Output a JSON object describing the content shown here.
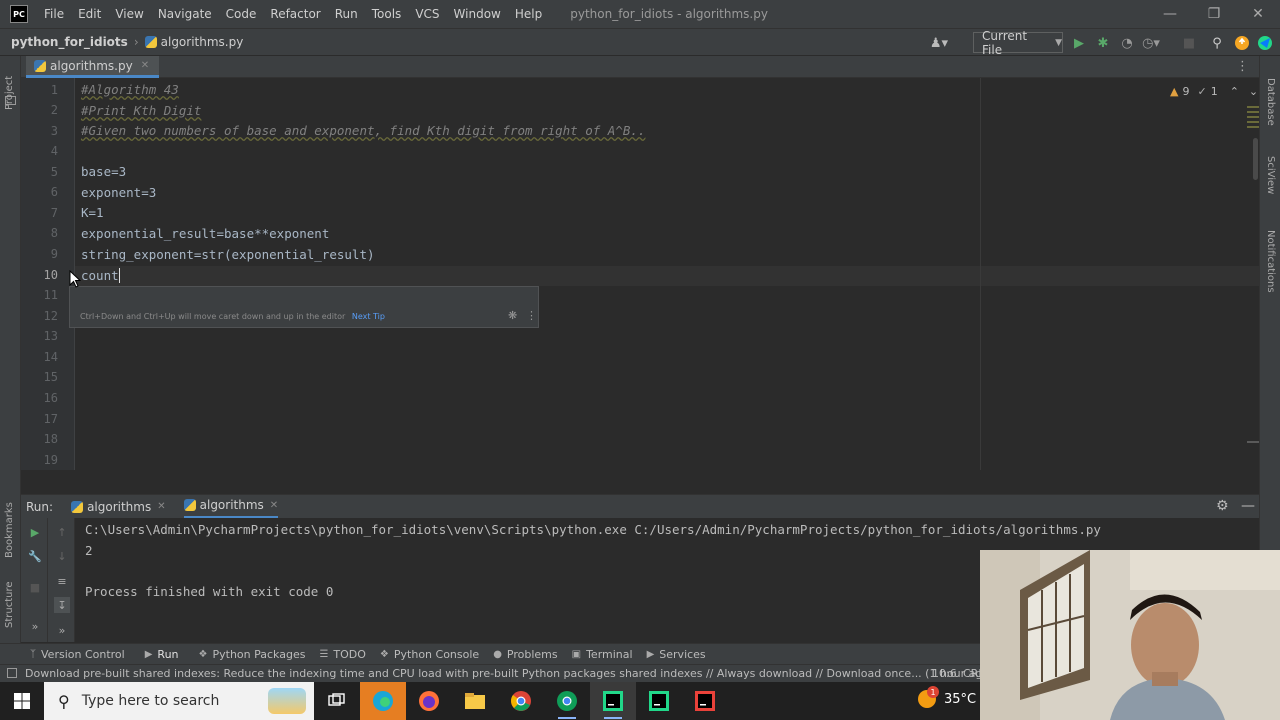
{
  "window": {
    "app_logo": "PC",
    "title": "python_for_idiots - algorithms.py",
    "menu": [
      "File",
      "Edit",
      "View",
      "Navigate",
      "Code",
      "Refactor",
      "Run",
      "Tools",
      "VCS",
      "Window",
      "Help"
    ]
  },
  "navbar": {
    "project": "python_for_idiots",
    "file": "algorithms.py",
    "run_config": "Current File"
  },
  "editor": {
    "tab_label": "algorithms.py",
    "inspection": {
      "warnings": "9",
      "weak_warnings": "1"
    },
    "line_numbers": [
      "1",
      "2",
      "3",
      "4",
      "5",
      "6",
      "7",
      "8",
      "9",
      "10",
      "11",
      "12",
      "13",
      "14",
      "15",
      "16",
      "17",
      "18",
      "19"
    ],
    "lines": [
      {
        "text": "#Algorithm 43",
        "kind": "comment"
      },
      {
        "text": "#Print Kth Digit",
        "kind": "comment"
      },
      {
        "text": "#Given two numbers of base and exponent, find Kth digit from right of A^B..",
        "kind": "comment"
      },
      {
        "text": "",
        "kind": "code"
      },
      {
        "text": "base=3",
        "kind": "code"
      },
      {
        "text": "exponent=3",
        "kind": "code"
      },
      {
        "text": "K=1",
        "kind": "code"
      },
      {
        "text": "exponential_result=base**exponent",
        "kind": "code"
      },
      {
        "text": "string_exponent=str(exponential_result)",
        "kind": "code"
      },
      {
        "text": "count",
        "kind": "code"
      }
    ],
    "tip": {
      "text": "Ctrl+Down and Ctrl+Up will move caret down and up in the editor",
      "link": "Next Tip"
    }
  },
  "side_labels": {
    "left": [
      "Project",
      "Bookmarks",
      "Structure"
    ],
    "right": [
      "Database",
      "SciView",
      "Notifications"
    ]
  },
  "run_panel": {
    "label": "Run:",
    "tabs": [
      "algorithms",
      "algorithms"
    ],
    "console": [
      "C:\\Users\\Admin\\PycharmProjects\\python_for_idiots\\venv\\Scripts\\python.exe C:/Users/Admin/PycharmProjects/python_for_idiots/algorithms.py",
      "2",
      "",
      "Process finished with exit code 0"
    ]
  },
  "tool_windows": [
    "Version Control",
    "Run",
    "Python Packages",
    "TODO",
    "Python Console",
    "Problems",
    "Terminal",
    "Services"
  ],
  "status": {
    "message": "Download pre-built shared indexes: Reduce the indexing time and CPU load with pre-built Python packages shared indexes // Always download // Download once... (1 hour ago)",
    "position": "10:6",
    "line_sep": "CRLF"
  },
  "taskbar": {
    "search_placeholder": "Type here to search",
    "weather_temp": "35°C",
    "weather_badge": "1"
  },
  "colors": {
    "accent": "#4a88c7",
    "editor_bg": "#2b2b2b",
    "chrome_bg": "#3c3f41",
    "run_green": "#59a869"
  }
}
